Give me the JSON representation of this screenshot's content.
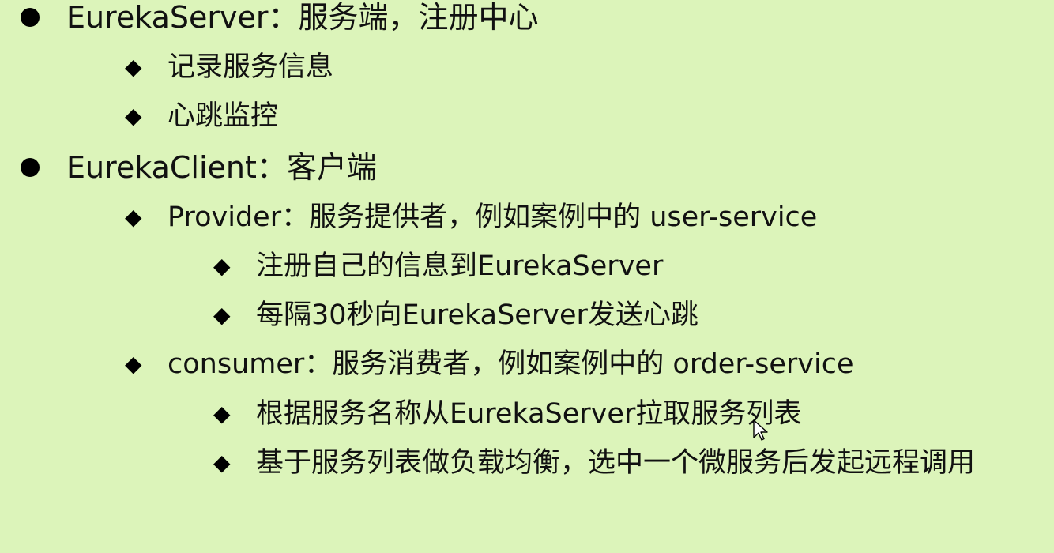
{
  "bullets": {
    "dot": "●",
    "diamond": "◆"
  },
  "items": [
    {
      "level": 1,
      "text": "EurekaServer：服务端，注册中心"
    },
    {
      "level": 2,
      "text": "记录服务信息"
    },
    {
      "level": 2,
      "text": "心跳监控"
    },
    {
      "level": 1,
      "text": "EurekaClient：客户端"
    },
    {
      "level": 2,
      "text": "Provider：服务提供者，例如案例中的 user-service"
    },
    {
      "level": 3,
      "text": "注册自己的信息到EurekaServer"
    },
    {
      "level": 3,
      "text": "每隔30秒向EurekaServer发送心跳"
    },
    {
      "level": 2,
      "text": "consumer：服务消费者，例如案例中的 order-service"
    },
    {
      "level": 3,
      "text": "根据服务名称从EurekaServer拉取服务列表"
    },
    {
      "level": 3,
      "text": "基于服务列表做负载均衡，选中一个微服务后发起远程调用"
    }
  ],
  "colors": {
    "background": "#dcf4ba",
    "text": "#111111"
  }
}
